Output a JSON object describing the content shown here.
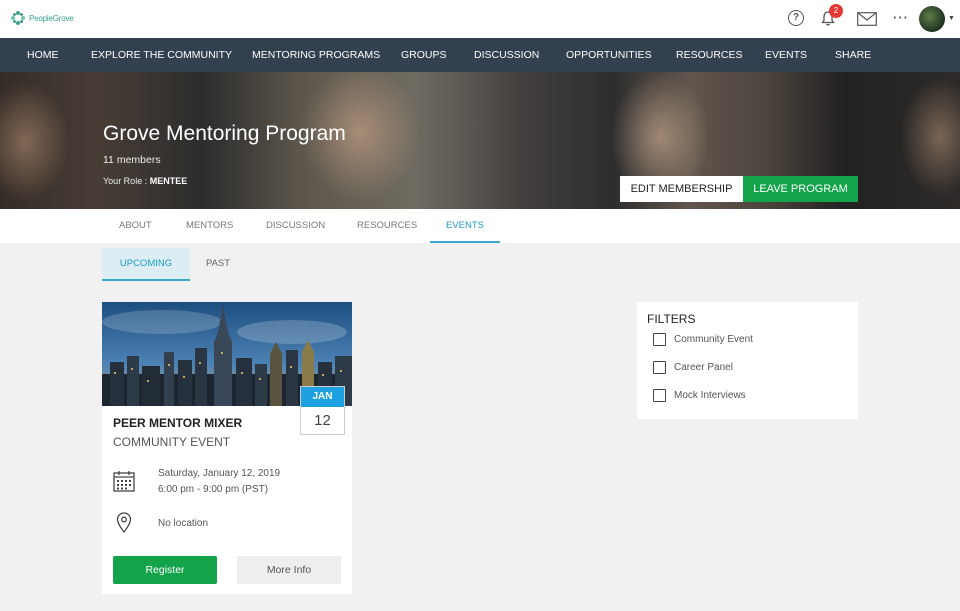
{
  "brand": {
    "logo_text": "PeopleGrove"
  },
  "topbar": {
    "help_icon": "help-icon",
    "notifications_count": "2",
    "mail_icon": "mail-icon",
    "more_label": "···"
  },
  "nav": {
    "items": [
      {
        "label": "HOME"
      },
      {
        "label": "EXPLORE THE COMMUNITY"
      },
      {
        "label": "MENTORING PROGRAMS"
      },
      {
        "label": "GROUPS"
      },
      {
        "label": "DISCUSSION"
      },
      {
        "label": "OPPORTUNITIES"
      },
      {
        "label": "RESOURCES"
      },
      {
        "label": "EVENTS"
      },
      {
        "label": "SHARE"
      }
    ]
  },
  "program": {
    "title": "Grove Mentoring Program",
    "members": "11 members",
    "role_label": "Your Role :",
    "role_value": "MENTEE",
    "edit_label": "EDIT MEMBERSHIP",
    "leave_label": "LEAVE PROGRAM"
  },
  "tabs": [
    {
      "label": "ABOUT"
    },
    {
      "label": "MENTORS"
    },
    {
      "label": "DISCUSSION"
    },
    {
      "label": "RESOURCES"
    },
    {
      "label": "EVENTS",
      "active": true
    }
  ],
  "event_tabs": [
    {
      "label": "UPCOMING",
      "active": true
    },
    {
      "label": "PAST"
    }
  ],
  "event": {
    "month": "JAN",
    "day": "12",
    "title": "PEER MENTOR MIXER",
    "type": "COMMUNITY EVENT",
    "date": "Saturday, January 12, 2019",
    "time": "6:00 pm - 9:00 pm (PST)",
    "location": "No location",
    "register_label": "Register",
    "more_label": "More Info"
  },
  "filters": {
    "title": "FILTERS",
    "options": [
      {
        "label": "Community Event",
        "checked": false
      },
      {
        "label": "Career Panel",
        "checked": false
      },
      {
        "label": "Mock Interviews",
        "checked": false
      }
    ]
  },
  "colors": {
    "nav_bg": "#33404f",
    "accent": "#1a9bc0",
    "green": "#13a34a",
    "date_blue": "#1da1e0"
  }
}
